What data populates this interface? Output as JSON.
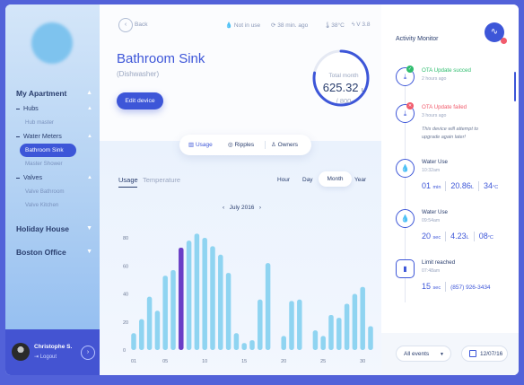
{
  "sidebar": {
    "title": "My Apartment",
    "hubs_label": "Hubs",
    "hub_master": "Hub master",
    "water_meters_label": "Water Meters",
    "bathroom_sink": "Bathroom Sink",
    "master_shower": "Master Shower",
    "valves_label": "Valves",
    "valve_bathroom": "Valve Bathroom",
    "valve_kitchen": "Valve Kitchen",
    "holiday_house": "Holiday House",
    "boston_office": "Boston Office"
  },
  "user": {
    "name": "Christophe S.",
    "logout": "Logout"
  },
  "header": {
    "back": "Back",
    "status": "Not in use",
    "synced": "38 min. ago",
    "temperature": "38°C",
    "voltage": "V 3.8"
  },
  "device": {
    "title": "Bathroom Sink",
    "subtitle": "(Dishwasher)",
    "edit_label": "Edit device"
  },
  "gauge": {
    "label": "Total month",
    "value": "625.32",
    "unit": "L",
    "total": "/ 800",
    "fraction": 0.78
  },
  "tabs": {
    "usage": "Usage",
    "ripples": "Ripples",
    "owners": "Owners"
  },
  "chart_controls": {
    "usage": "Usage",
    "temperature": "Temperature",
    "hour": "Hour",
    "day": "Day",
    "month": "Month",
    "year": "Year",
    "period": "July 2016",
    "prev": "‹",
    "next": "›"
  },
  "chart_data": {
    "type": "bar",
    "x": [
      1,
      2,
      3,
      4,
      5,
      6,
      7,
      8,
      9,
      10,
      11,
      12,
      13,
      14,
      15,
      16,
      17,
      18,
      19,
      20,
      21,
      22,
      23,
      24,
      25,
      26,
      27,
      28,
      29,
      30,
      31
    ],
    "x_tick_labels": [
      "01",
      "05",
      "10",
      "15",
      "20",
      "25",
      "30"
    ],
    "values": [
      12,
      22,
      38,
      28,
      53,
      57,
      73,
      78,
      83,
      80,
      74,
      68,
      55,
      12,
      5,
      7,
      36,
      62,
      0,
      10,
      35,
      36,
      0,
      14,
      10,
      25,
      23,
      33,
      40,
      45,
      17
    ],
    "highlight_index": 6,
    "ylim": [
      0,
      80
    ],
    "y_tick_labels": [
      "0",
      "20",
      "40",
      "60",
      "80"
    ],
    "grid": false,
    "colors": {
      "bar": "#8fd4f1",
      "highlight": "#6a3ec6"
    }
  },
  "activity": {
    "title": "Activity Monitor",
    "items": [
      {
        "title": "OTA Update succed",
        "time": "2 hours ago"
      },
      {
        "title": "OTA Update failed",
        "time": "3 hours ago",
        "desc": "This device will attempt to upgrade again later!"
      },
      {
        "title": "Water Use",
        "time": "10:32am",
        "v1": "01",
        "u1": "min",
        "v2": "20.86",
        "u2": "L",
        "v3": "34",
        "u3": "°C"
      },
      {
        "title": "Water Use",
        "time": "09:54am",
        "v1": "20",
        "u1": "sec",
        "v2": "4.23",
        "u2": "L",
        "v3": "08",
        "u3": "°C"
      },
      {
        "title": "Limit reached",
        "time": "07:48am",
        "v1": "15",
        "u1": "sec",
        "contact": "(857) 926-3434"
      }
    ],
    "filter": "All events",
    "date": "12/07/16"
  },
  "colors": {
    "primary": "#3d56d8",
    "success": "#2ebd6e",
    "danger": "#f15b6c",
    "bar": "#8fd4f1",
    "highlight": "#6a3ec6"
  }
}
